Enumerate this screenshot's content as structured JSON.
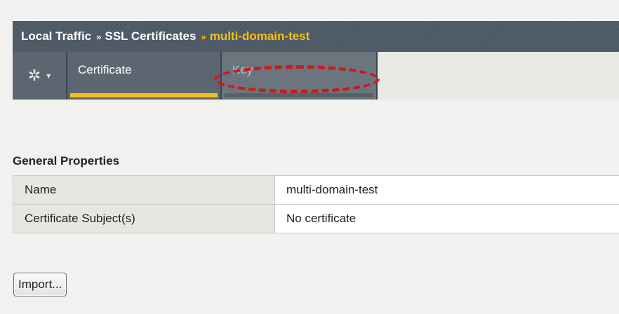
{
  "breadcrumb": {
    "section": "Local Traffic",
    "separator": "»",
    "page": "SSL Certificates",
    "current": "multi-domain-test"
  },
  "tabs": {
    "gear_icon": "gear-icon",
    "items": [
      {
        "label": "Certificate",
        "active": true
      },
      {
        "label": "Key",
        "active": false
      }
    ]
  },
  "annotation": {
    "color": "#cc1a1a"
  },
  "general_properties": {
    "title": "General Properties",
    "rows": [
      {
        "label": "Name",
        "value": "multi-domain-test"
      },
      {
        "label": "Certificate Subject(s)",
        "value": "No certificate"
      }
    ]
  },
  "actions": {
    "import_label": "Import..."
  },
  "colors": {
    "accent": "#f2c11b",
    "header_bg": "#4d5a66",
    "tab_bg": "#5c6670"
  }
}
